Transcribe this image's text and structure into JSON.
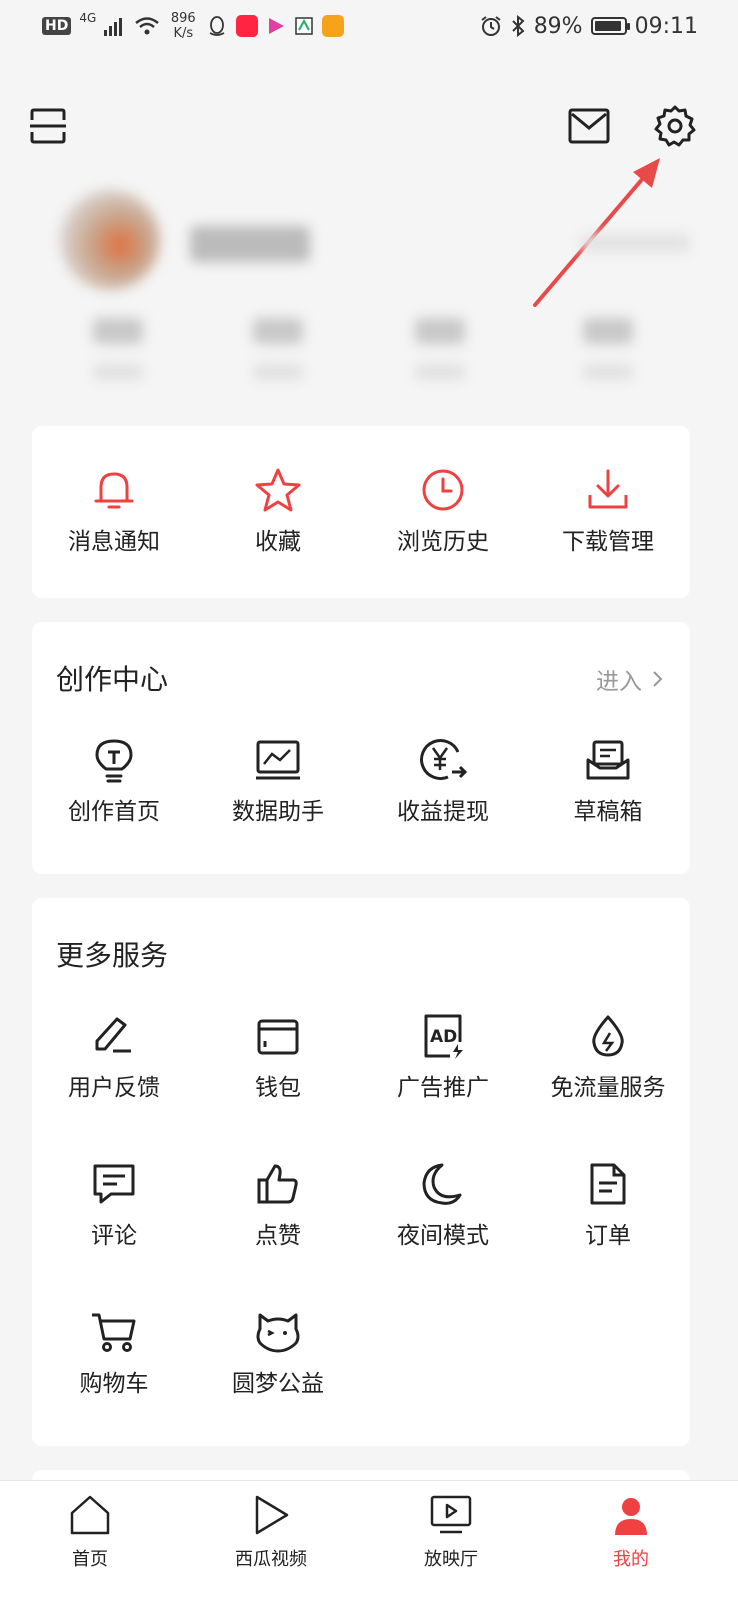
{
  "status_bar": {
    "hd": "HD",
    "network": "4G",
    "speed_value": "896",
    "speed_unit": "K/s",
    "battery": "89%",
    "time": "09:11"
  },
  "header": {
    "scan_icon": "scan-icon",
    "mail_icon": "mail-icon",
    "settings_icon": "gear-icon"
  },
  "quick_actions": [
    {
      "label": "消息通知",
      "icon": "bell-icon"
    },
    {
      "label": "收藏",
      "icon": "star-icon"
    },
    {
      "label": "浏览历史",
      "icon": "clock-icon"
    },
    {
      "label": "下载管理",
      "icon": "download-icon"
    }
  ],
  "creator_center": {
    "title": "创作中心",
    "enter_label": "进入",
    "items": [
      {
        "label": "创作首页",
        "icon": "lightbulb-icon"
      },
      {
        "label": "数据助手",
        "icon": "chart-monitor-icon"
      },
      {
        "label": "收益提现",
        "icon": "yuan-withdraw-icon"
      },
      {
        "label": "草稿箱",
        "icon": "drafts-icon"
      }
    ]
  },
  "more_services": {
    "title": "更多服务",
    "items": [
      {
        "label": "用户反馈",
        "icon": "pencil-icon"
      },
      {
        "label": "钱包",
        "icon": "wallet-icon"
      },
      {
        "label": "广告推广",
        "icon": "ad-icon"
      },
      {
        "label": "免流量服务",
        "icon": "drop-icon"
      },
      {
        "label": "评论",
        "icon": "comment-icon"
      },
      {
        "label": "点赞",
        "icon": "thumbs-up-icon"
      },
      {
        "label": "夜间模式",
        "icon": "moon-icon"
      },
      {
        "label": "订单",
        "icon": "order-icon"
      },
      {
        "label": "购物车",
        "icon": "cart-icon"
      },
      {
        "label": "圆梦公益",
        "icon": "charity-icon"
      }
    ]
  },
  "bottom_nav": [
    {
      "label": "首页",
      "icon": "home-icon"
    },
    {
      "label": "西瓜视频",
      "icon": "play-icon"
    },
    {
      "label": "放映厅",
      "icon": "tv-play-icon"
    },
    {
      "label": "我的",
      "icon": "profile-icon",
      "active": true
    }
  ],
  "colors": {
    "accent": "#f04142",
    "annotation_arrow": "#e84a4a"
  }
}
